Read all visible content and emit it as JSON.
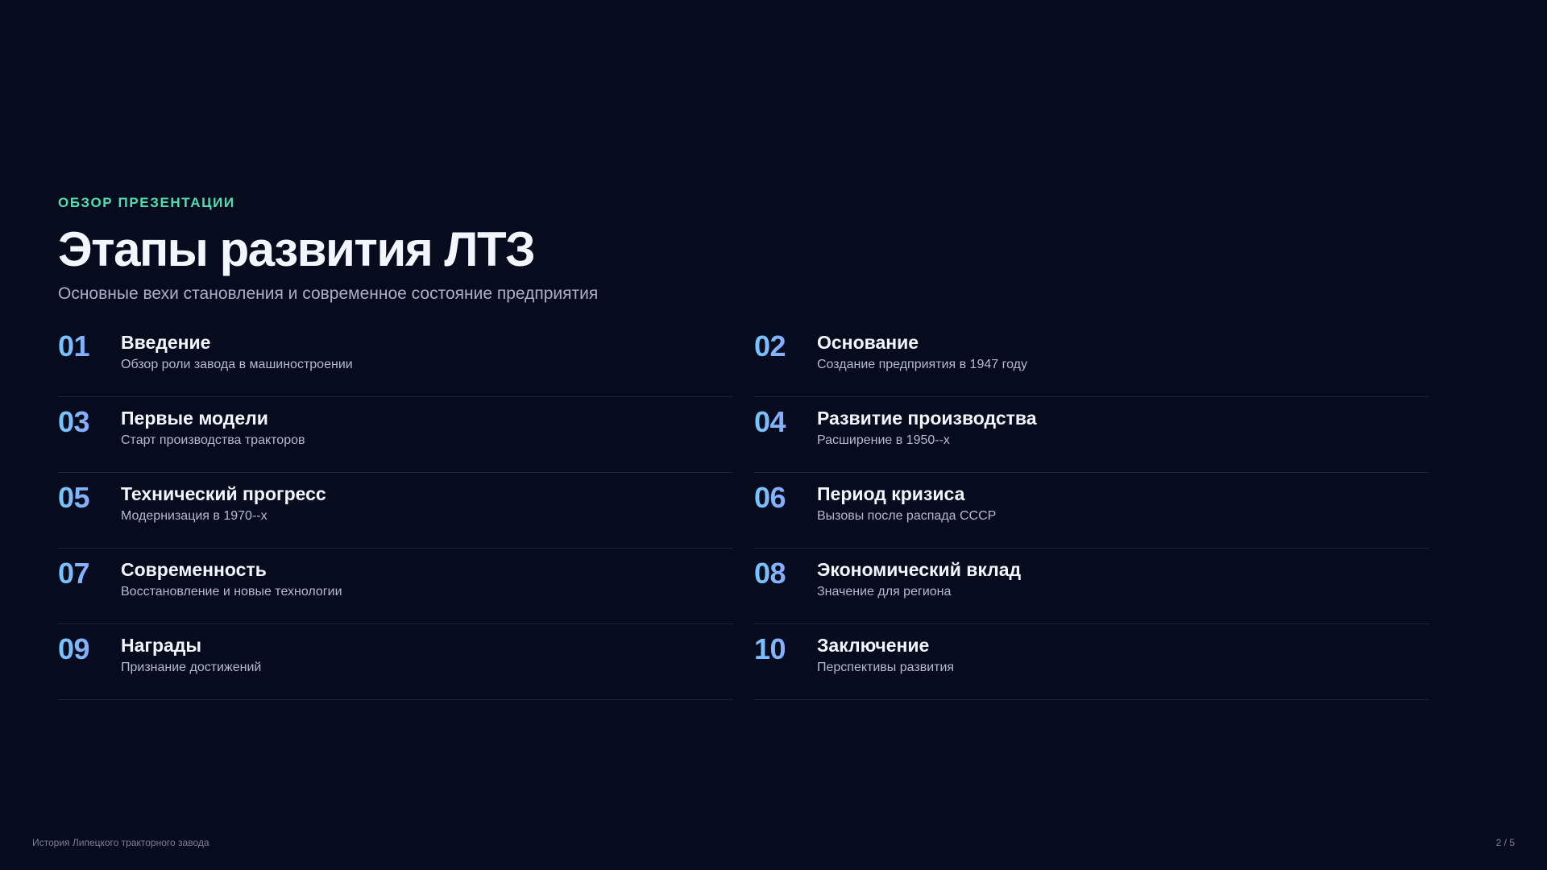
{
  "slide": {
    "eyebrow": "ОБЗОР ПРЕЗЕНТАЦИИ",
    "title": "Этапы развития ЛТЗ",
    "subtitle": "Основные вехи становления и современное состояние предприятия"
  },
  "items": [
    {
      "num": "01",
      "title": "Введение",
      "desc": "Обзор роли завода в машиностроении"
    },
    {
      "num": "02",
      "title": "Основание",
      "desc": "Создание предприятия в 1947 году"
    },
    {
      "num": "03",
      "title": "Первые модели",
      "desc": "Старт производства тракторов"
    },
    {
      "num": "04",
      "title": "Развитие производства",
      "desc": "Расширение в 1950--х"
    },
    {
      "num": "05",
      "title": "Технический прогресс",
      "desc": "Модернизация в 1970--х"
    },
    {
      "num": "06",
      "title": "Период кризиса",
      "desc": "Вызовы после распада СССР"
    },
    {
      "num": "07",
      "title": "Современность",
      "desc": "Восстановление и новые технологии"
    },
    {
      "num": "08",
      "title": "Экономический вклад",
      "desc": "Значение для региона"
    },
    {
      "num": "09",
      "title": "Награды",
      "desc": "Признание достижений"
    },
    {
      "num": "10",
      "title": "Заключение",
      "desc": "Перспективы развития"
    }
  ],
  "footer": {
    "left": "История Липецкого тракторного завода",
    "page": "2 / 5"
  },
  "colors": {
    "background": "#070b1e",
    "accent": "#4fe0b0",
    "number_gradient_start": "#73c8ff",
    "number_gradient_end": "#9d8dff"
  }
}
